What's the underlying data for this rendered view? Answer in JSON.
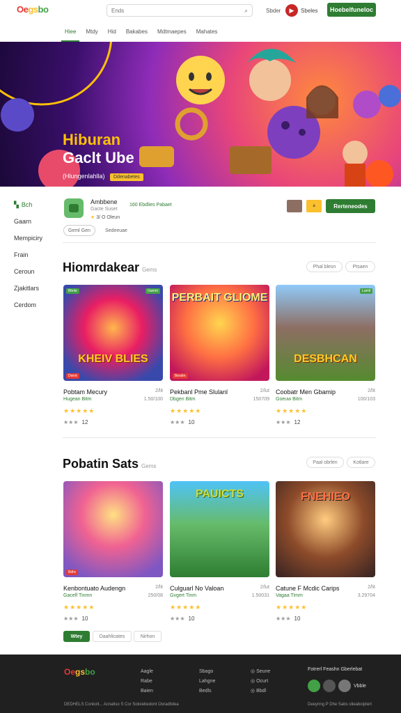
{
  "header": {
    "logo": [
      "Oe",
      "gs",
      "bo"
    ],
    "search_placeholder": "Ends",
    "link": "Sbder",
    "user_label": "Sbeles",
    "cta": "Hoebelfuneloc"
  },
  "nav": [
    "Hiee",
    "Mtdy",
    "Hid",
    "Bakabes",
    "Mdtmaepes",
    "Mahates"
  ],
  "hero": {
    "title_1": "Hiburan",
    "title_2": "Gaclt Ube",
    "subtitle": "(Hlungenlahlla)",
    "badge": "Ddenabetes"
  },
  "sidebar": [
    "Bch",
    "Gaarn",
    "Mempiciry",
    "Frain",
    "Ceroun",
    "Zjakitlars",
    "Cerdom"
  ],
  "app": {
    "title": "Ambbene",
    "dev": "Gacte Suset",
    "rating_text": "3/ O Oleun",
    "link": "160 Ebdlies Pabaet",
    "install": "Rerteneodes",
    "thumb_label": "a",
    "chips": [
      "Geml Gen",
      "Sedeeuae"
    ]
  },
  "section1": {
    "title": "Hiomrdakear",
    "sub": "Gems",
    "pills": [
      "Phal blesn",
      "Ptsaen"
    ],
    "cards": [
      {
        "name": "Pobtam Mecury",
        "size": "2/lit",
        "dev": "Hugean Bitm",
        "dl": "1.50/100",
        "votes": "12",
        "art": "KHEIV BLIES",
        "tags": [
          "Bhnle",
          "Gamm",
          "Dwrst"
        ]
      },
      {
        "name": "Pekbanl Pme Slulanl",
        "size": "2/lut",
        "dev": "Dbgen Bitm",
        "dl": "150709",
        "votes": "10",
        "art": "PERBAIT GLIOME",
        "tags": [
          "",
          "",
          "Bexdm"
        ]
      },
      {
        "name": "Coobatr Men Gbamip",
        "size": "2/lit",
        "dev": "Goeuw Bitm",
        "dl": "100/103",
        "votes": "12",
        "art": "DESBHCAN",
        "tags": [
          "",
          "Lamll",
          ""
        ]
      }
    ]
  },
  "section2": {
    "title": "Pobatin Sats",
    "sub": "Gems",
    "pills": [
      "Paal obrlen",
      "Kotlare"
    ],
    "cards": [
      {
        "name": "Kenbontuato Audengn",
        "size": "2/lit",
        "dev": "Gacelf Tinmn",
        "dl": "250/08",
        "votes": "10",
        "art": "",
        "tags": [
          "",
          "",
          "Bdhc"
        ]
      },
      {
        "name": "Culguarl No Valoan",
        "size": "2/lut",
        "dev": "Gvgert Tinm",
        "dl": "1.50031",
        "votes": "10",
        "art": "PAUICTS",
        "tags": [
          "",
          "",
          ""
        ]
      },
      {
        "name": "Catune F Mcdic Carips",
        "size": "2/lit",
        "dev": "Vagaa Timm",
        "dl": "3.29704",
        "votes": "10",
        "art": "FNEHIEO",
        "tags": [
          "",
          "",
          ""
        ]
      }
    ],
    "buttons": [
      "Wtey",
      "Daahlicates",
      "Nirhon"
    ]
  },
  "footer": {
    "logo": [
      "Oe",
      "gs",
      "bo"
    ],
    "col1": [
      "Aagle",
      "Rabe",
      "Baien"
    ],
    "col2": [
      "Sbago",
      "Lahgne",
      "Bedls"
    ],
    "col3": [
      "Seune",
      "Ocurt",
      "Bbdl"
    ],
    "right_title": "Fotrerl Feashn Gberlebat",
    "store_label": "Vbble",
    "copy_left": "DEDHELS Conkolt... Acnatlso S Cor Soloiebedont Ooradtidea",
    "copy_right": "Deeyring P Dhe Sabs olieaboiptert"
  },
  "colors": {
    "accent": "#2e7d32",
    "star": "#fbc02d",
    "footer_bg": "#202020"
  }
}
